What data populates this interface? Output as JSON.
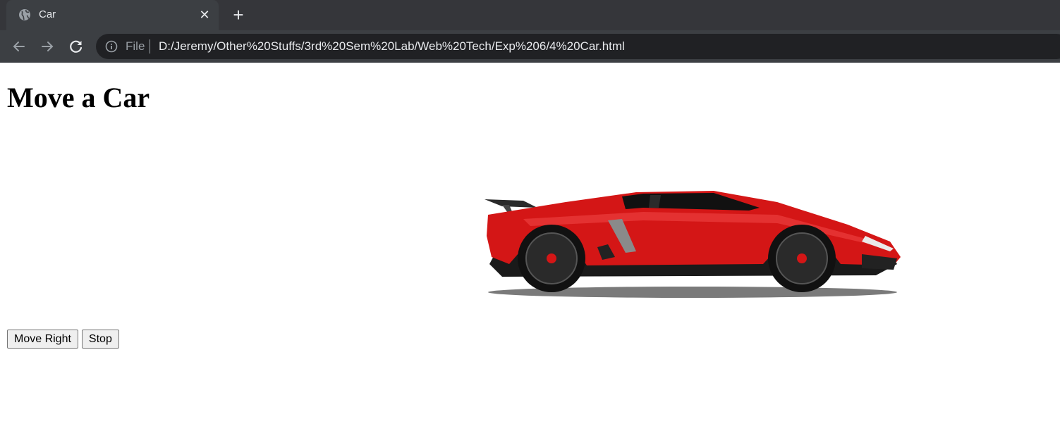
{
  "browser": {
    "tab": {
      "title": "Car",
      "favicon": "globe-icon",
      "close_icon": "close-icon"
    },
    "new_tab_icon": "plus-icon",
    "nav": {
      "back_icon": "back-arrow-icon",
      "forward_icon": "forward-arrow-icon",
      "reload_icon": "reload-icon"
    },
    "address_bar": {
      "info_icon": "info-icon",
      "scheme_label": "File",
      "url": "D:/Jeremy/Other%20Stuffs/3rd%20Sem%20Lab/Web%20Tech/Exp%206/4%20Car.html"
    }
  },
  "page": {
    "heading": "Move a Car",
    "car_image": "red-sports-car-image",
    "buttons": {
      "move_right": "Move Right",
      "stop": "Stop"
    }
  },
  "colors": {
    "tabstrip": "#35363a",
    "toolbar": "#3c3f43",
    "omnibox": "#202124",
    "car_body": "#d41616"
  }
}
